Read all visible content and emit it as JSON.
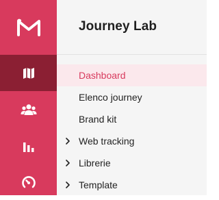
{
  "app": {
    "logo_icon": "m-logo-icon",
    "accent_color": "#d83a5d",
    "active_rail_color": "#8b1f33"
  },
  "rail": {
    "items": [
      {
        "icon": "map-icon",
        "active": true
      },
      {
        "icon": "users-icon",
        "active": false
      },
      {
        "icon": "bar-chart-icon",
        "active": false
      },
      {
        "icon": "gauge-icon",
        "active": false
      }
    ]
  },
  "panel": {
    "title": "Journey Lab",
    "items": [
      {
        "label": "Dashboard",
        "active": true,
        "expandable": false
      },
      {
        "label": "Elenco journey",
        "active": false,
        "expandable": false
      },
      {
        "label": "Brand kit",
        "active": false,
        "expandable": false
      },
      {
        "label": "Web tracking",
        "active": false,
        "expandable": true,
        "expand_icon": "chevron-right-icon"
      },
      {
        "label": "Librerie",
        "active": false,
        "expandable": true,
        "expand_icon": "chevron-right-icon"
      },
      {
        "label": "Template",
        "active": false,
        "expandable": true,
        "expand_icon": "chevron-right-icon"
      }
    ]
  }
}
